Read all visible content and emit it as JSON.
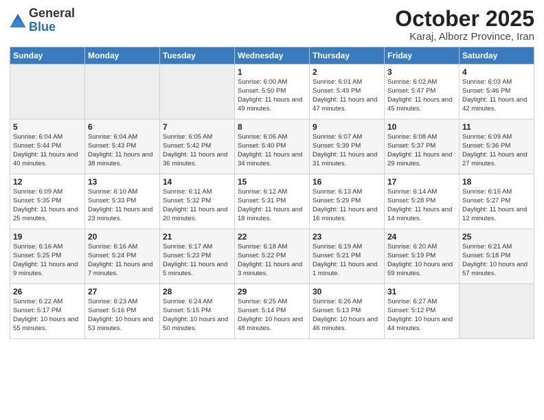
{
  "header": {
    "logo_general": "General",
    "logo_blue": "Blue",
    "title": "October 2025",
    "subtitle": "Karaj, Alborz Province, Iran"
  },
  "days_of_week": [
    "Sunday",
    "Monday",
    "Tuesday",
    "Wednesday",
    "Thursday",
    "Friday",
    "Saturday"
  ],
  "weeks": [
    [
      {
        "day": "",
        "info": ""
      },
      {
        "day": "",
        "info": ""
      },
      {
        "day": "",
        "info": ""
      },
      {
        "day": "1",
        "info": "Sunrise: 6:00 AM\nSunset: 5:50 PM\nDaylight: 11 hours\nand 49 minutes."
      },
      {
        "day": "2",
        "info": "Sunrise: 6:01 AM\nSunset: 5:49 PM\nDaylight: 11 hours\nand 47 minutes."
      },
      {
        "day": "3",
        "info": "Sunrise: 6:02 AM\nSunset: 5:47 PM\nDaylight: 11 hours\nand 45 minutes."
      },
      {
        "day": "4",
        "info": "Sunrise: 6:03 AM\nSunset: 5:46 PM\nDaylight: 11 hours\nand 42 minutes."
      }
    ],
    [
      {
        "day": "5",
        "info": "Sunrise: 6:04 AM\nSunset: 5:44 PM\nDaylight: 11 hours\nand 40 minutes."
      },
      {
        "day": "6",
        "info": "Sunrise: 6:04 AM\nSunset: 5:43 PM\nDaylight: 11 hours\nand 38 minutes."
      },
      {
        "day": "7",
        "info": "Sunrise: 6:05 AM\nSunset: 5:42 PM\nDaylight: 11 hours\nand 36 minutes."
      },
      {
        "day": "8",
        "info": "Sunrise: 6:06 AM\nSunset: 5:40 PM\nDaylight: 11 hours\nand 34 minutes."
      },
      {
        "day": "9",
        "info": "Sunrise: 6:07 AM\nSunset: 5:39 PM\nDaylight: 11 hours\nand 31 minutes."
      },
      {
        "day": "10",
        "info": "Sunrise: 6:08 AM\nSunset: 5:37 PM\nDaylight: 11 hours\nand 29 minutes."
      },
      {
        "day": "11",
        "info": "Sunrise: 6:09 AM\nSunset: 5:36 PM\nDaylight: 11 hours\nand 27 minutes."
      }
    ],
    [
      {
        "day": "12",
        "info": "Sunrise: 6:09 AM\nSunset: 5:35 PM\nDaylight: 11 hours\nand 25 minutes."
      },
      {
        "day": "13",
        "info": "Sunrise: 6:10 AM\nSunset: 5:33 PM\nDaylight: 11 hours\nand 23 minutes."
      },
      {
        "day": "14",
        "info": "Sunrise: 6:11 AM\nSunset: 5:32 PM\nDaylight: 11 hours\nand 20 minutes."
      },
      {
        "day": "15",
        "info": "Sunrise: 6:12 AM\nSunset: 5:31 PM\nDaylight: 11 hours\nand 18 minutes."
      },
      {
        "day": "16",
        "info": "Sunrise: 6:13 AM\nSunset: 5:29 PM\nDaylight: 11 hours\nand 16 minutes."
      },
      {
        "day": "17",
        "info": "Sunrise: 6:14 AM\nSunset: 5:28 PM\nDaylight: 11 hours\nand 14 minutes."
      },
      {
        "day": "18",
        "info": "Sunrise: 6:15 AM\nSunset: 5:27 PM\nDaylight: 11 hours\nand 12 minutes."
      }
    ],
    [
      {
        "day": "19",
        "info": "Sunrise: 6:16 AM\nSunset: 5:25 PM\nDaylight: 11 hours\nand 9 minutes."
      },
      {
        "day": "20",
        "info": "Sunrise: 6:16 AM\nSunset: 5:24 PM\nDaylight: 11 hours\nand 7 minutes."
      },
      {
        "day": "21",
        "info": "Sunrise: 6:17 AM\nSunset: 5:23 PM\nDaylight: 11 hours\nand 5 minutes."
      },
      {
        "day": "22",
        "info": "Sunrise: 6:18 AM\nSunset: 5:22 PM\nDaylight: 11 hours\nand 3 minutes."
      },
      {
        "day": "23",
        "info": "Sunrise: 6:19 AM\nSunset: 5:21 PM\nDaylight: 11 hours\nand 1 minute."
      },
      {
        "day": "24",
        "info": "Sunrise: 6:20 AM\nSunset: 5:19 PM\nDaylight: 10 hours\nand 59 minutes."
      },
      {
        "day": "25",
        "info": "Sunrise: 6:21 AM\nSunset: 5:18 PM\nDaylight: 10 hours\nand 57 minutes."
      }
    ],
    [
      {
        "day": "26",
        "info": "Sunrise: 6:22 AM\nSunset: 5:17 PM\nDaylight: 10 hours\nand 55 minutes."
      },
      {
        "day": "27",
        "info": "Sunrise: 6:23 AM\nSunset: 5:16 PM\nDaylight: 10 hours\nand 53 minutes."
      },
      {
        "day": "28",
        "info": "Sunrise: 6:24 AM\nSunset: 5:15 PM\nDaylight: 10 hours\nand 50 minutes."
      },
      {
        "day": "29",
        "info": "Sunrise: 6:25 AM\nSunset: 5:14 PM\nDaylight: 10 hours\nand 48 minutes."
      },
      {
        "day": "30",
        "info": "Sunrise: 6:26 AM\nSunset: 5:13 PM\nDaylight: 10 hours\nand 46 minutes."
      },
      {
        "day": "31",
        "info": "Sunrise: 6:27 AM\nSunset: 5:12 PM\nDaylight: 10 hours\nand 44 minutes."
      },
      {
        "day": "",
        "info": ""
      }
    ]
  ]
}
